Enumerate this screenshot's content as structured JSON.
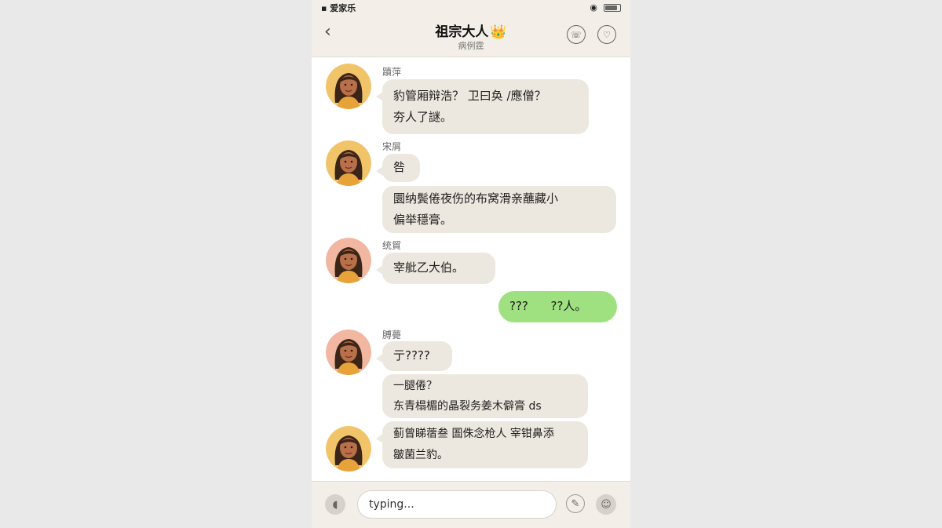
{
  "status_bar": {
    "left_text": "▪ 爱家乐",
    "location_icon": "location-icon",
    "battery_icon": "battery-icon"
  },
  "header": {
    "title": "祖宗大人",
    "crown_icon": "👑",
    "subtitle": "病例霆"
  },
  "messages": [
    {
      "sender": "蹟萍",
      "lines": [
        "豹管厢辩浩？ 卫曰奂 /應僧？",
        "夯人了謎。"
      ]
    },
    {
      "sender": "宋屑",
      "lines": [
        "咎"
      ]
    },
    {
      "sender": "",
      "lines": [
        "圜纳鬓倦夜伤的布窝滑亲蘸藏小",
        "偏举穩膏。"
      ]
    },
    {
      "sender": "统貿",
      "lines": [
        "宰舭乙大伯。"
      ]
    },
    {
      "sender": "me",
      "lines": [
        "???      ??人。"
      ]
    },
    {
      "sender": "膊薨",
      "lines": [
        "亍????"
      ]
    },
    {
      "sender": "",
      "lines": [
        "一腿倦？",
        "东青榻楣的晶裂务姜木僻膏 ds"
      ]
    },
    {
      "sender": "",
      "lines": [
        "蓟曾睇蓿叁 圄侏念枪人 宰钳鼻添",
        "皺菌兰豹。"
      ]
    }
  ],
  "input": {
    "value": "typing..."
  },
  "colors": {
    "header_bg": "#f3efe8",
    "bubble_other": "#ede8df",
    "bubble_me": "#9fe080",
    "crown": "#f2b12a"
  }
}
